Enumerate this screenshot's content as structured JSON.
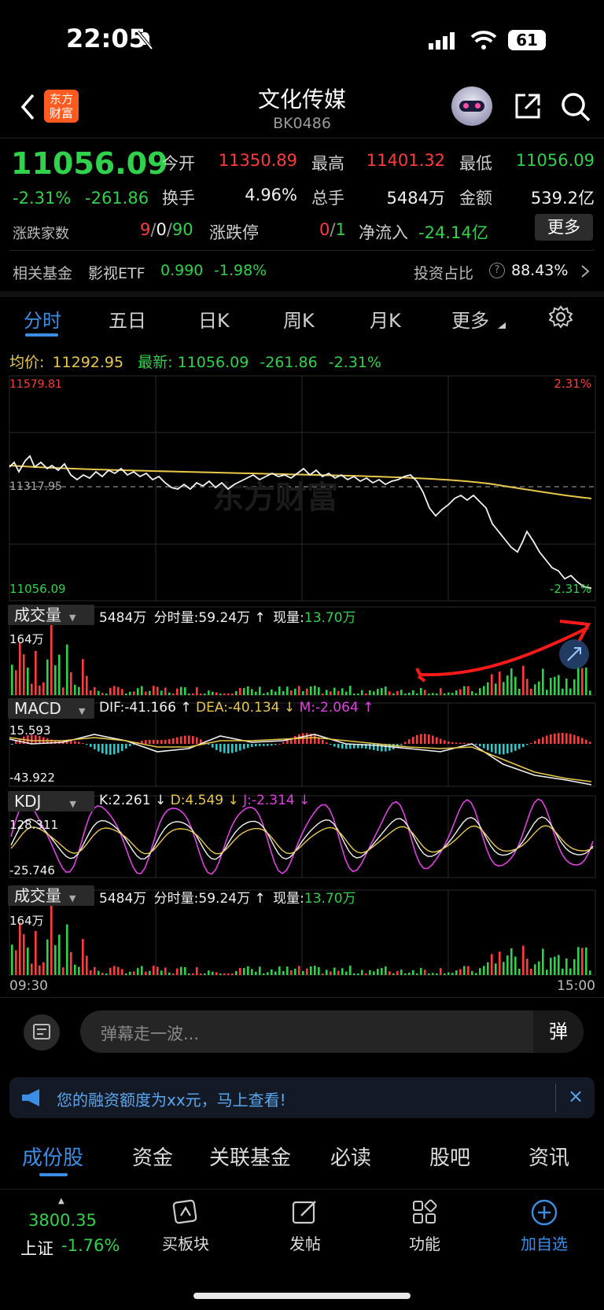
{
  "status_bar": {
    "time": "22:05",
    "battery": "61"
  },
  "header": {
    "title": "文化传媒",
    "code": "BK0486",
    "logo_text": "东方财富"
  },
  "quote": {
    "last": "11056.09",
    "change_pct": "-2.31%",
    "change": "-261.86",
    "open_label": "今开",
    "open": "11350.89",
    "high_label": "最高",
    "high": "11401.32",
    "low_label": "最低",
    "low": "11056.09",
    "turnover_label": "换手",
    "turnover": "4.96%",
    "volume_label": "总手",
    "volume": "5484万",
    "amount_label": "金额",
    "amount": "539.2亿",
    "breadth_label": "涨跌家数",
    "breadth_up": "9",
    "breadth_flat": "0",
    "breadth_down": "90",
    "limit_label": "涨跌停",
    "limit_up": "0",
    "limit_down": "1",
    "netflow_label": "净流入",
    "netflow": "-24.14亿",
    "more_label": "更多"
  },
  "fund_row": {
    "label": "相关基金",
    "fund": "影视ETF",
    "price": "0.990",
    "change": "-1.98%",
    "ratio_label": "投资占比",
    "ratio": "88.43%"
  },
  "tabs": [
    "分时",
    "五日",
    "日K",
    "周K",
    "月K",
    "更多"
  ],
  "intraday": {
    "avg_label": "均价:",
    "avg": "11292.95",
    "latest_label": "最新:",
    "latest": "11056.09",
    "latest_change": "-261.86",
    "latest_pct": "-2.31%",
    "top_price": "11579.81",
    "top_pct": "2.31%",
    "mid_price": "11317.95",
    "bottom_price": "11056.09",
    "bottom_pct": "-2.31%",
    "watermark": "东方财富"
  },
  "volume_panel": {
    "label": "成交量",
    "total": "5484万",
    "minute_label": "分时量:",
    "minute": "59.24万",
    "now_label": "现量:",
    "now": "13.70万",
    "axis_top": "164万"
  },
  "macd_panel": {
    "label": "MACD",
    "dif": "DIF:-41.166",
    "dea": "DEA:-40.134",
    "m": "M:-2.064",
    "axis_top": "15.593",
    "axis_bottom": "-43.922"
  },
  "kdj_panel": {
    "label": "KDJ",
    "k": "K:2.261",
    "d": "D:4.549",
    "j": "J:-2.314",
    "axis_top": "128.311",
    "axis_bottom": "-25.746"
  },
  "volume_panel2": {
    "label": "成交量",
    "total": "5484万",
    "minute_label": "分时量:",
    "minute": "59.24万",
    "now_label": "现量:",
    "now": "13.70万",
    "axis_top": "164万"
  },
  "time_axis": {
    "start": "09:30",
    "end": "15:00"
  },
  "comment": {
    "placeholder": "弹幕走一波...",
    "danmu_btn": "弹"
  },
  "banner": {
    "text": "您的融资额度为xx元，马上查看!"
  },
  "bottom_tabs": [
    "成份股",
    "资金",
    "关联基金",
    "必读",
    "股吧",
    "资讯"
  ],
  "bottom_nav": {
    "index_value": "3800.35",
    "index_name": "上证",
    "index_change": "-1.76%",
    "items": [
      "买板块",
      "发帖",
      "功能",
      "加自选"
    ]
  },
  "colors": {
    "up": "#ff3b3b",
    "down": "#2fd24a",
    "avg_line": "#e8c84a",
    "accent": "#3a8ee6"
  }
}
